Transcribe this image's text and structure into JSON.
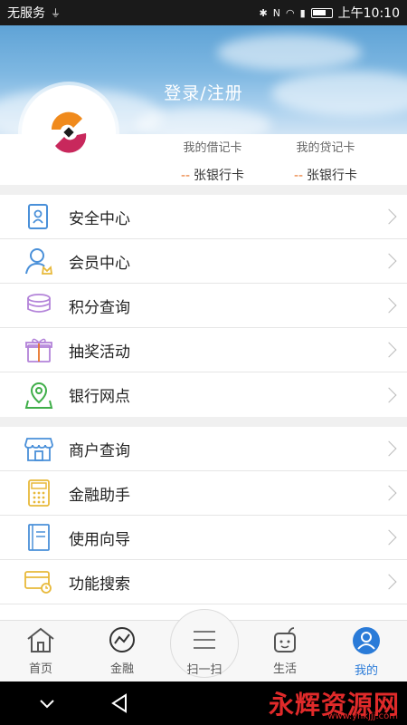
{
  "status_bar": {
    "carrier": "无服务",
    "time": "上午10:10"
  },
  "header": {
    "login_label": "登录/注册"
  },
  "cards": {
    "debit": {
      "label": "我的借记卡",
      "dash": "--",
      "value": "张银行卡"
    },
    "credit": {
      "label": "我的贷记卡",
      "dash": "--",
      "value": "张银行卡"
    }
  },
  "menu_group_1": [
    {
      "label": "安全中心",
      "icon": "shield-card-icon"
    },
    {
      "label": "会员中心",
      "icon": "member-icon"
    },
    {
      "label": "积分查询",
      "icon": "coins-icon"
    },
    {
      "label": "抽奖活动",
      "icon": "gift-icon"
    },
    {
      "label": "银行网点",
      "icon": "location-pin-icon"
    }
  ],
  "menu_group_2": [
    {
      "label": "商户查询",
      "icon": "shop-icon"
    },
    {
      "label": "金融助手",
      "icon": "calculator-icon"
    },
    {
      "label": "使用向导",
      "icon": "book-icon"
    },
    {
      "label": "功能搜索",
      "icon": "card-search-icon"
    }
  ],
  "bottom_nav": [
    {
      "label": "首页",
      "icon": "home-icon"
    },
    {
      "label": "金融",
      "icon": "finance-chart-icon"
    },
    {
      "label": "扫一扫",
      "icon": "scan-icon"
    },
    {
      "label": "生活",
      "icon": "life-cup-icon"
    },
    {
      "label": "我的",
      "icon": "profile-icon",
      "active": true
    }
  ],
  "watermark": {
    "text": "永辉资源网",
    "url": "www.yhkjjj.com"
  },
  "colors": {
    "accent": "#2a7bd8",
    "orange": "#e8742a",
    "status_bar": "#1a1a1a"
  }
}
